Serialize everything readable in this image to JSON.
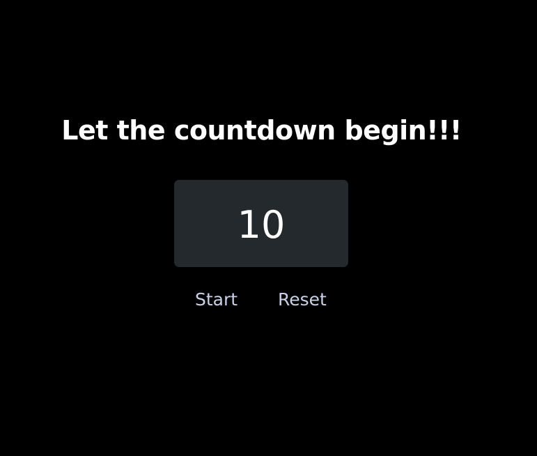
{
  "page": {
    "title": "Let the countdown begin!!!"
  },
  "counter": {
    "value": "10"
  },
  "controls": {
    "start_label": "Start",
    "reset_label": "Reset"
  },
  "colors": {
    "background": "#000000",
    "counter_box": "#23292c",
    "title_text": "#ffffff",
    "button_text": "#c9d1e8"
  }
}
